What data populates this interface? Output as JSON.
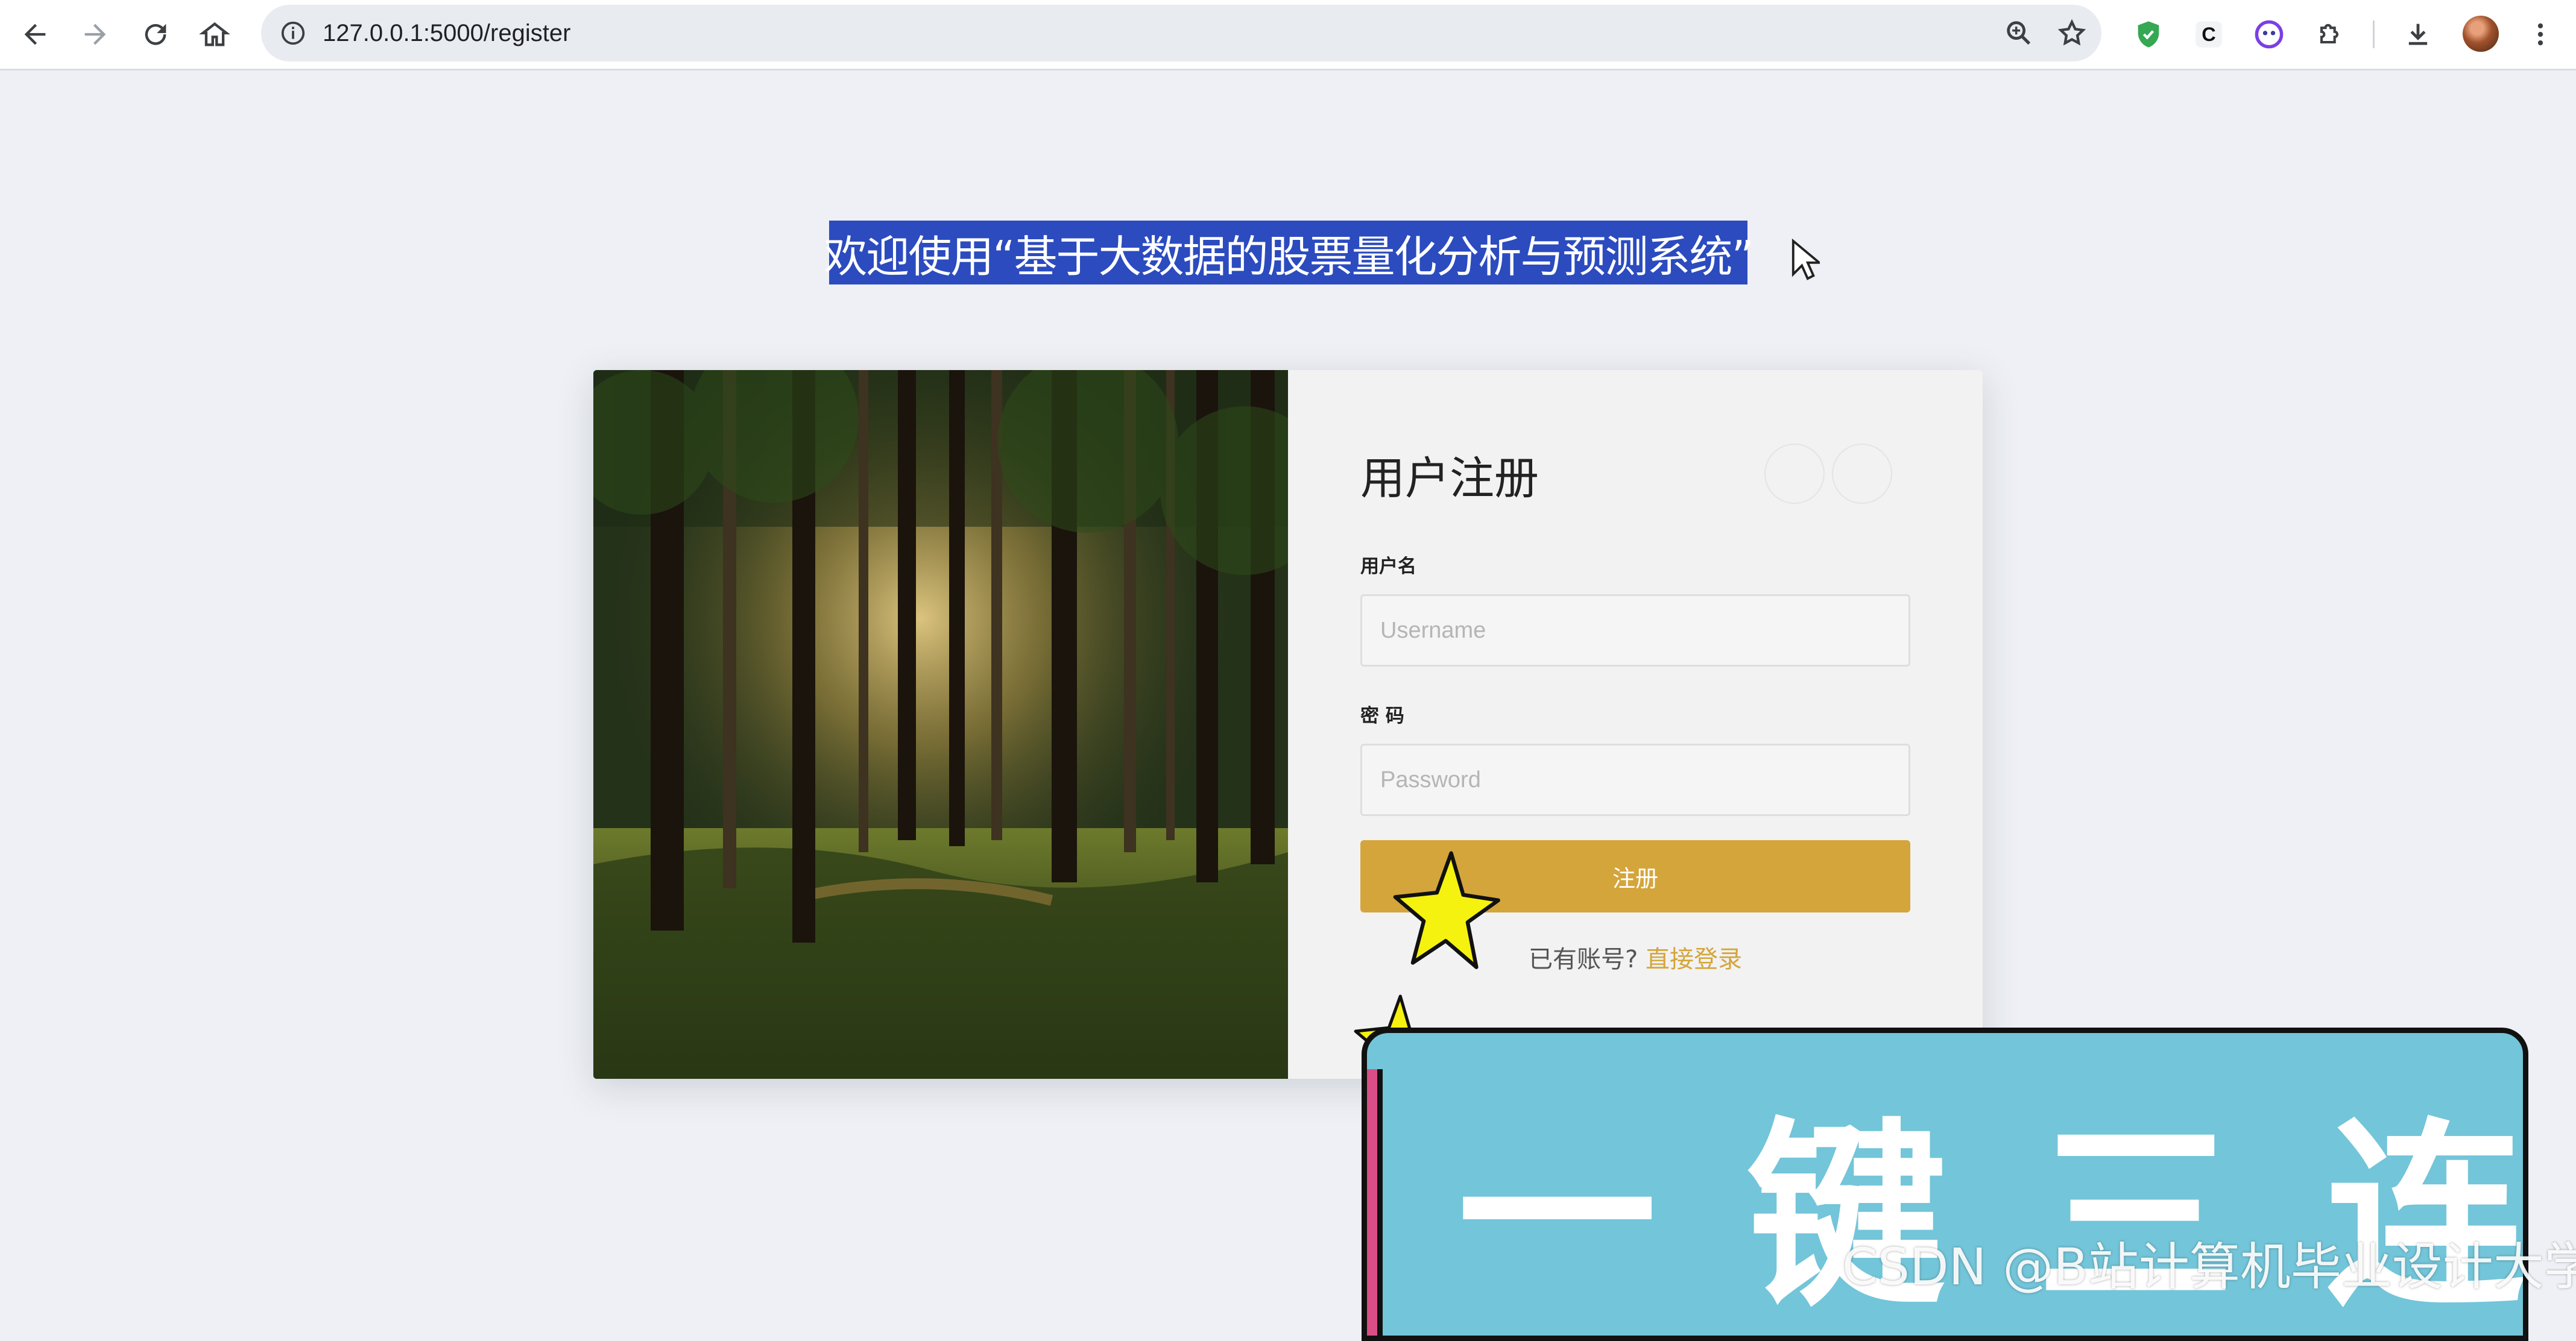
{
  "browser": {
    "url": "127.0.0.1:5000/register",
    "icons": [
      "back-icon",
      "forward-icon",
      "reload-icon",
      "home-icon",
      "site-info-icon",
      "zoom-icon",
      "bookmark-star-icon",
      "shield-extension-icon",
      "c-extension-icon",
      "face-extension-icon",
      "puzzle-extensions-icon",
      "download-icon",
      "profile-avatar",
      "menu-icon"
    ]
  },
  "page": {
    "headline": "欢迎使用“基于大数据的股票量化分析与预测系统”"
  },
  "register_form": {
    "title": "用户注册",
    "username_label": "用户名",
    "username_placeholder": "Username",
    "password_label": "密 码",
    "password_placeholder": "Password",
    "submit_label": "注册",
    "login_prompt": "已有账号?",
    "login_link": "直接登录"
  },
  "overlay": {
    "banner_text": "一键三连",
    "watermark": "CSDN @B站计算机毕业设计大学"
  },
  "colors": {
    "accent": "#d4a53b",
    "selection": "#2b4bbf",
    "page_bg": "#eef0f5",
    "banner": "#73c5d9",
    "star": "#f5f20f"
  }
}
